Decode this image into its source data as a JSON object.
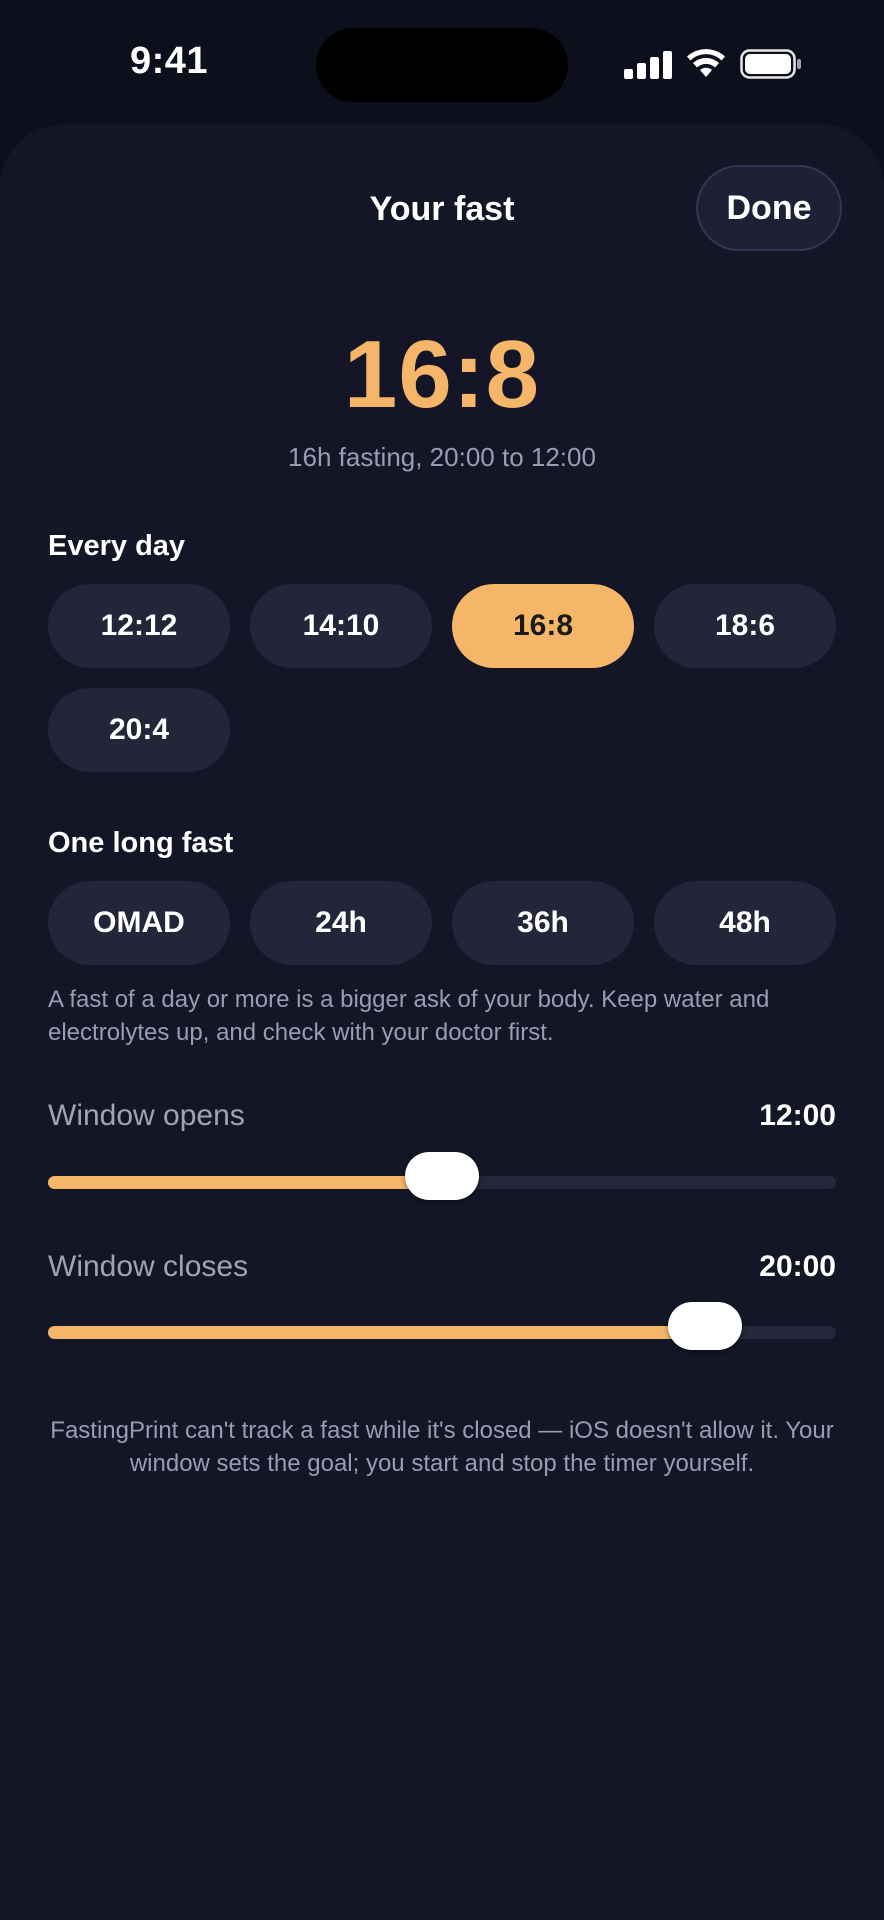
{
  "status_bar": {
    "time": "9:41"
  },
  "sheet": {
    "title": "Your fast",
    "done_label": "Done"
  },
  "summary": {
    "ratio": "16:8",
    "description": "16h fasting, 20:00 to 12:00"
  },
  "every_day": {
    "label": "Every day",
    "options": [
      "12:12",
      "14:10",
      "16:8",
      "18:6",
      "20:4"
    ],
    "selected": "16:8"
  },
  "long_fast": {
    "label": "One long fast",
    "options": [
      "OMAD",
      "24h",
      "36h",
      "48h"
    ],
    "note": "A fast of a day or more is a bigger ask of your body. Keep water and electrolytes up, and check with your doctor first."
  },
  "window_opens": {
    "label": "Window opens",
    "value": "12:00",
    "fraction": 0.5
  },
  "window_closes": {
    "label": "Window closes",
    "value": "20:00",
    "fraction": 0.8333
  },
  "footer_note": "FastingPrint can't track a fast while it's closed — iOS doesn't allow it. Your window sets the goal; you start and stop the timer yourself.",
  "colors": {
    "accent": "#f5b66a",
    "background": "#0d0f1c",
    "sheet": "#141627",
    "chip": "#232539"
  }
}
